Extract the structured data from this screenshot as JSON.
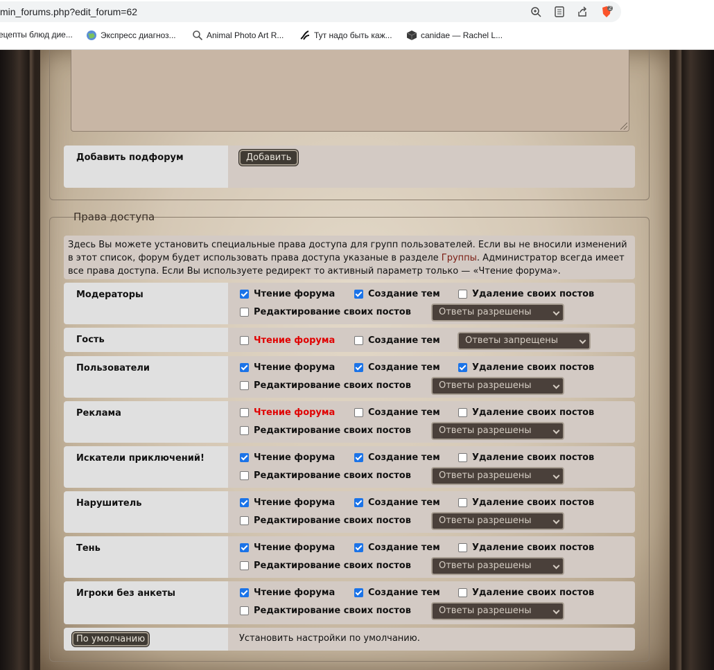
{
  "browser": {
    "url": "min_forums.php?edit_forum=62",
    "bookmarks": [
      {
        "label": "ецепты блюд дие...",
        "icon": "none"
      },
      {
        "label": "Экспресс диагноз...",
        "icon": "globe-icon"
      },
      {
        "label": "Animal Photo Art R...",
        "icon": "search-icon"
      },
      {
        "label": "Тут надо быть каж...",
        "icon": "swirl-icon"
      },
      {
        "label": "canidae — Rachel L...",
        "icon": "cube-icon"
      }
    ],
    "brave_badge": "2"
  },
  "subforum": {
    "label": "Добавить подфорум",
    "button": "Добавить"
  },
  "permissions": {
    "legend": "Права доступа",
    "info_before_link": "Здесь Вы можете установить специальные права доступа для групп пользователей. Если вы не вносили изменений в этот список, форум будет использовать права доступа указаные в разделе ",
    "info_link": "Группы",
    "info_after_link": ". Администратор всегда имеет все права доступа. Если Вы используете редирект то активный параметр только — «Чтение форума».",
    "labels": {
      "read": "Чтение форума",
      "create": "Создание тем",
      "delete": "Удаление своих постов",
      "edit": "Редактирование своих постов"
    },
    "groups": [
      {
        "name": "Модераторы",
        "read": true,
        "create": true,
        "delete": false,
        "edit": false,
        "replies": "Ответы разрешены"
      },
      {
        "name": "Гость",
        "read": false,
        "create": false,
        "replies": "Ответы запрещены",
        "read_red": true
      },
      {
        "name": "Пользователи",
        "read": true,
        "create": true,
        "delete": true,
        "edit": false,
        "replies": "Ответы разрешены"
      },
      {
        "name": "Реклама",
        "read": false,
        "create": false,
        "delete": false,
        "edit": false,
        "replies": "Ответы разрешены",
        "read_red": true
      },
      {
        "name": "Искатели приключений!",
        "read": true,
        "create": true,
        "delete": false,
        "edit": false,
        "replies": "Ответы разрешены"
      },
      {
        "name": "Нарушитель",
        "read": true,
        "create": true,
        "delete": false,
        "edit": false,
        "replies": "Ответы разрешены"
      },
      {
        "name": "Тень",
        "read": true,
        "create": true,
        "delete": false,
        "edit": false,
        "replies": "Ответы разрешены"
      },
      {
        "name": "Игроки без анкеты",
        "read": true,
        "create": true,
        "delete": false,
        "edit": false,
        "replies": "Ответы разрешены"
      }
    ],
    "default_button": "По умолчанию",
    "default_text": "Установить настройки по умолчанию."
  }
}
